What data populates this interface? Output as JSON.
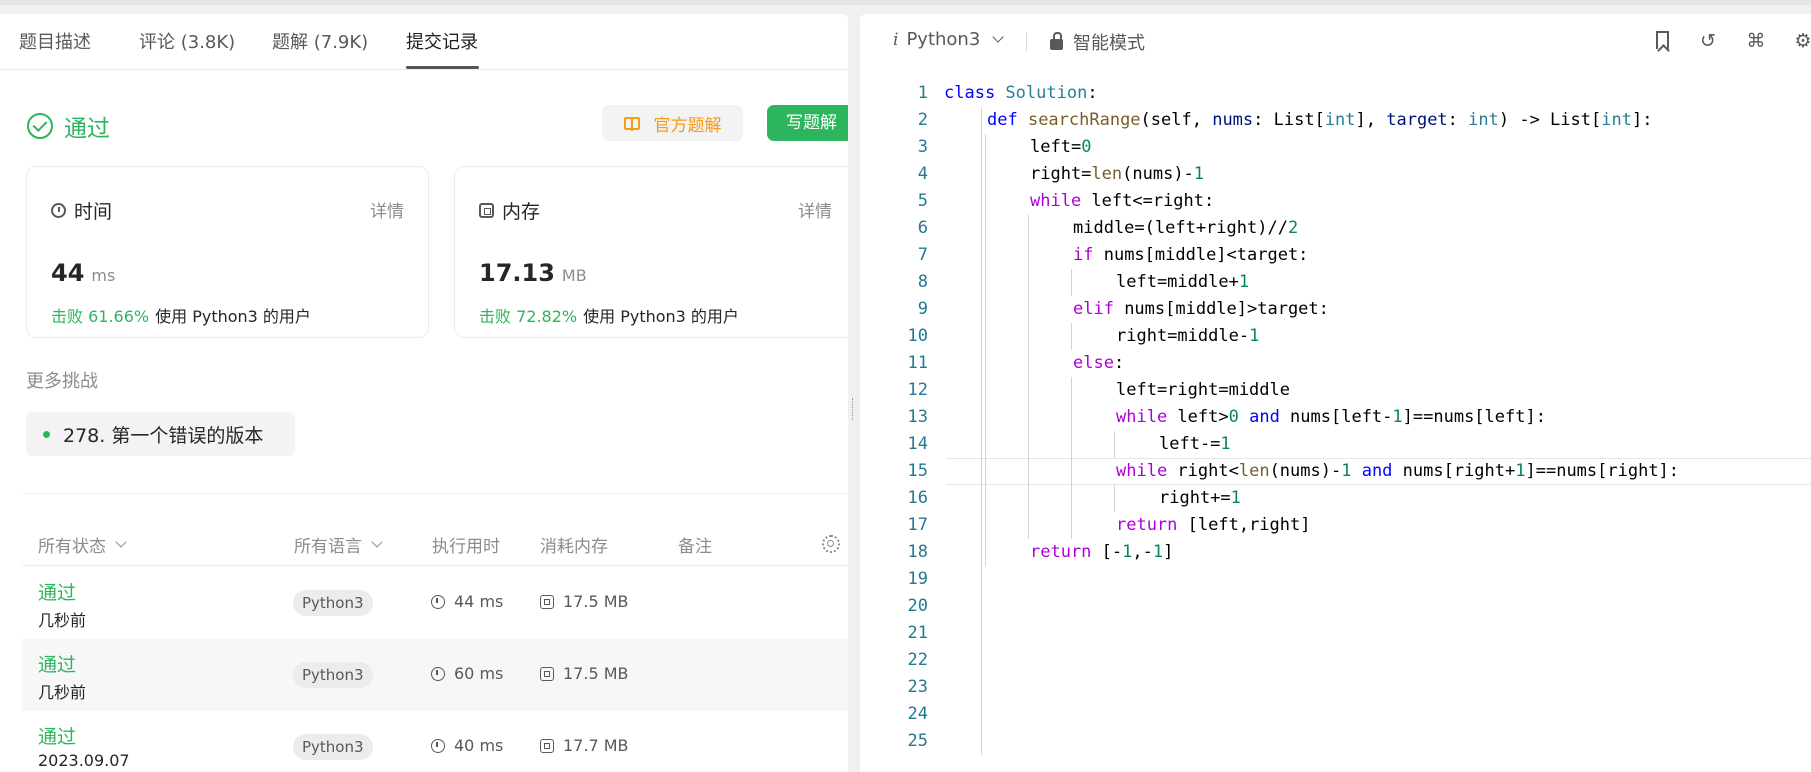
{
  "tabs": [
    {
      "label": "题目描述"
    },
    {
      "label": "评论 (3.8K)"
    },
    {
      "label": "题解 (7.9K)"
    },
    {
      "label": "提交记录"
    }
  ],
  "status": {
    "label": "通过",
    "color": "#2db55d"
  },
  "buttons": {
    "official": "官方题解",
    "write": "写题解"
  },
  "runtime_card": {
    "title": "时间",
    "detail": "详情",
    "value": "44",
    "unit": "ms",
    "beat": "击败 61.66%",
    "beat_suffix": "使用 Python3 的用户"
  },
  "memory_card": {
    "title": "内存",
    "detail": "详情",
    "value": "17.13",
    "unit": "MB",
    "beat": "击败 72.82%",
    "beat_suffix": "使用 Python3 的用户"
  },
  "more": {
    "title": "更多挑战",
    "item": "278. 第一个错误的版本"
  },
  "table": {
    "headers": {
      "status": "所有状态",
      "lang": "所有语言",
      "runtime": "执行用时",
      "memory": "消耗内存",
      "note": "备注"
    },
    "rows": [
      {
        "status": "通过",
        "time": "几秒前",
        "lang": "Python3",
        "runtime": "44 ms",
        "memory": "17.5 MB"
      },
      {
        "status": "通过",
        "time": "几秒前",
        "lang": "Python3",
        "runtime": "60 ms",
        "memory": "17.5 MB"
      },
      {
        "status": "通过",
        "time": "2023.09.07",
        "lang": "Python3",
        "runtime": "40 ms",
        "memory": "17.7 MB"
      }
    ]
  },
  "editor_toolbar": {
    "lang_prefix": "i",
    "language": "Python3",
    "mode": "智能模式"
  },
  "editor": {
    "current_line": 15,
    "lines": [
      {
        "n": "1",
        "indent": 0
      },
      {
        "n": "2",
        "indent": 1
      },
      {
        "n": "3",
        "indent": 2
      },
      {
        "n": "4",
        "indent": 2
      },
      {
        "n": "5",
        "indent": 2
      },
      {
        "n": "6",
        "indent": 3
      },
      {
        "n": "7",
        "indent": 3
      },
      {
        "n": "8",
        "indent": 4
      },
      {
        "n": "9",
        "indent": 3
      },
      {
        "n": "10",
        "indent": 4
      },
      {
        "n": "11",
        "indent": 3
      },
      {
        "n": "12",
        "indent": 4
      },
      {
        "n": "13",
        "indent": 4
      },
      {
        "n": "14",
        "indent": 5
      },
      {
        "n": "15",
        "indent": 4
      },
      {
        "n": "16",
        "indent": 5
      },
      {
        "n": "17",
        "indent": 4
      },
      {
        "n": "18",
        "indent": 2
      },
      {
        "n": "19",
        "indent": 0
      },
      {
        "n": "20",
        "indent": 0
      },
      {
        "n": "21",
        "indent": 0
      },
      {
        "n": "22",
        "indent": 0
      },
      {
        "n": "23",
        "indent": 0
      },
      {
        "n": "24",
        "indent": 0
      },
      {
        "n": "25",
        "indent": 0
      }
    ],
    "code": [
      [
        [
          "kb",
          "class "
        ],
        [
          "cls",
          "Solution"
        ],
        [
          "op",
          ":"
        ]
      ],
      [
        [
          "kb",
          "def "
        ],
        [
          "fn",
          "searchRange"
        ],
        [
          "op",
          "(self, "
        ],
        [
          "pr",
          "nums"
        ],
        [
          "op",
          ": List["
        ],
        [
          "cls",
          "int"
        ],
        [
          "op",
          "], "
        ],
        [
          "pr",
          "target"
        ],
        [
          "op",
          ": "
        ],
        [
          "cls",
          "int"
        ],
        [
          "op",
          ") -> List["
        ],
        [
          "cls",
          "int"
        ],
        [
          "op",
          "]:"
        ]
      ],
      [
        [
          "op",
          "left="
        ],
        [
          "num",
          "0"
        ]
      ],
      [
        [
          "op",
          "right="
        ],
        [
          "fn",
          "len"
        ],
        [
          "op",
          "(nums)-"
        ],
        [
          "num",
          "1"
        ]
      ],
      [
        [
          "kw",
          "while "
        ],
        [
          "op",
          "left<=right:"
        ]
      ],
      [
        [
          "op",
          "middle=(left+right)//"
        ],
        [
          "num",
          "2"
        ]
      ],
      [
        [
          "kw",
          "if "
        ],
        [
          "op",
          "nums[middle]<target:"
        ]
      ],
      [
        [
          "op",
          "left=middle+"
        ],
        [
          "num",
          "1"
        ]
      ],
      [
        [
          "kw",
          "elif "
        ],
        [
          "op",
          "nums[middle]>target:"
        ]
      ],
      [
        [
          "op",
          "right=middle-"
        ],
        [
          "num",
          "1"
        ]
      ],
      [
        [
          "kw",
          "else"
        ],
        [
          "op",
          ":"
        ]
      ],
      [
        [
          "op",
          "left=right=middle"
        ]
      ],
      [
        [
          "kw",
          "while "
        ],
        [
          "op",
          "left>"
        ],
        [
          "num",
          "0"
        ],
        [
          "kb",
          " and "
        ],
        [
          "op",
          "nums[left-"
        ],
        [
          "num",
          "1"
        ],
        [
          "op",
          "]==nums[left]:"
        ]
      ],
      [
        [
          "op",
          "left-="
        ],
        [
          "num",
          "1"
        ]
      ],
      [
        [
          "kw",
          "while "
        ],
        [
          "op",
          "right<"
        ],
        [
          "fn",
          "len"
        ],
        [
          "op",
          "(nums)-"
        ],
        [
          "num",
          "1"
        ],
        [
          "kb",
          " and "
        ],
        [
          "op",
          "nums[right+"
        ],
        [
          "num",
          "1"
        ],
        [
          "op",
          "]==nums[right]:"
        ]
      ],
      [
        [
          "op",
          "right+="
        ],
        [
          "num",
          "1"
        ]
      ],
      [
        [
          "kw",
          "return "
        ],
        [
          "op",
          "[left,right]"
        ]
      ],
      [
        [
          "kw",
          "return "
        ],
        [
          "op",
          "[-"
        ],
        [
          "num",
          "1"
        ],
        [
          "op",
          ",-"
        ],
        [
          "num",
          "1"
        ],
        [
          "op",
          "]"
        ]
      ],
      [],
      [],
      [],
      [],
      [],
      [],
      []
    ]
  }
}
